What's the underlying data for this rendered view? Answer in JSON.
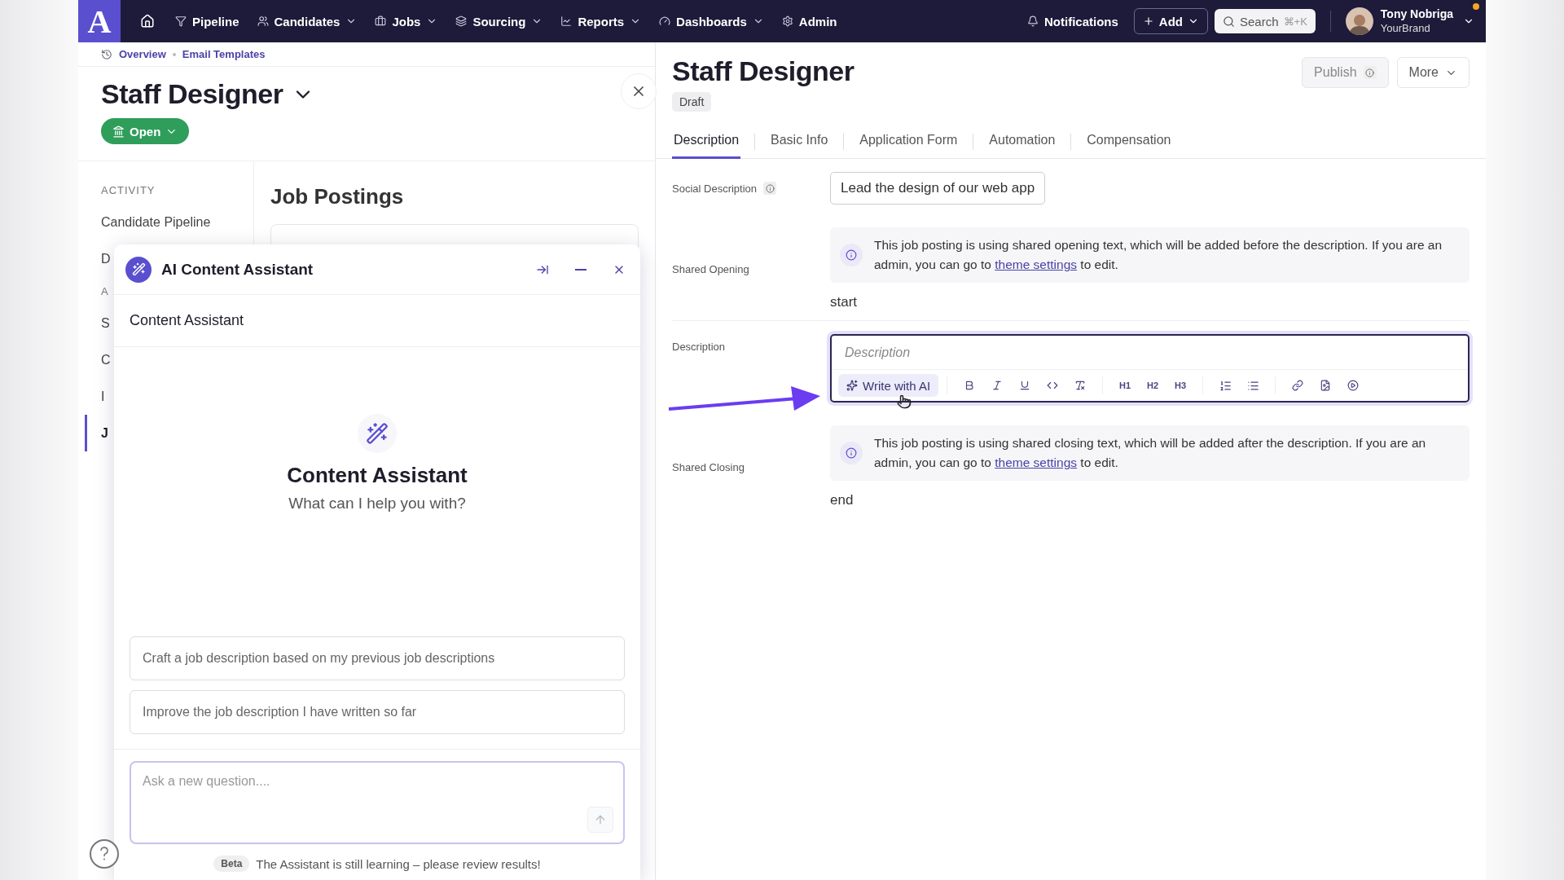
{
  "nav": {
    "logo": "A",
    "items": [
      {
        "label": "Pipeline",
        "dropdown": false
      },
      {
        "label": "Candidates",
        "dropdown": true
      },
      {
        "label": "Jobs",
        "dropdown": true
      },
      {
        "label": "Sourcing",
        "dropdown": true
      },
      {
        "label": "Reports",
        "dropdown": true
      },
      {
        "label": "Dashboards",
        "dropdown": true
      },
      {
        "label": "Admin",
        "dropdown": false
      }
    ],
    "notifications": "Notifications",
    "add": "Add",
    "search": "Search",
    "shortcut": "⌘+K",
    "user": {
      "name": "Tony Nobriga",
      "company": "YourBrand",
      "unread": true
    }
  },
  "left": {
    "breadcrumbs": [
      "Overview",
      "Email Templates"
    ],
    "title": "Staff Designer",
    "status": "Open",
    "sidebar": [
      {
        "kind": "heading",
        "label": "ACTIVITY"
      },
      {
        "kind": "link",
        "label": "Candidate Pipeline",
        "selected": false
      },
      {
        "kind": "link",
        "label": "D",
        "selected": false
      },
      {
        "kind": "heading",
        "label": "A"
      },
      {
        "kind": "link",
        "label": "S",
        "selected": false
      },
      {
        "kind": "link",
        "label": "C",
        "selected": false
      },
      {
        "kind": "link",
        "label": "I",
        "selected": false
      },
      {
        "kind": "link",
        "label": "J",
        "selected": true
      }
    ],
    "section_title": "Job Postings"
  },
  "assistant": {
    "title": "AI Content Assistant",
    "subtitle": "Content Assistant",
    "hero_title": "Content Assistant",
    "hero_text": "What can I help you with?",
    "suggestions": [
      "Craft a job description based on my previous job descriptions",
      "Improve the job description I have written so far"
    ],
    "question": {
      "placeholder": "Ask a new question...."
    },
    "beta": "Beta",
    "footer": "The Assistant is still learning – please review results!"
  },
  "right": {
    "title": "Staff Designer",
    "badge": "Draft",
    "publish": "Publish",
    "more": "More",
    "tabs": [
      {
        "label": "Description",
        "selected": true
      },
      {
        "label": "Basic Info",
        "selected": false
      },
      {
        "label": "Application Form",
        "selected": false
      },
      {
        "label": "Automation",
        "selected": false
      },
      {
        "label": "Compensation",
        "selected": false
      }
    ],
    "social": {
      "label": "Social Description",
      "value": "Lead the design of our web app"
    },
    "opening": {
      "label": "Shared Opening",
      "before": "This job posting is using shared opening text, which will be added before the description. If you are an admin, you can go to ",
      "link": "theme settings",
      "after": " to edit.",
      "text": "start"
    },
    "description": {
      "label": "Description",
      "placeholder": "Description",
      "ai_button": "Write with AI",
      "headings": [
        "H1",
        "H2",
        "H3"
      ]
    },
    "closing": {
      "label": "Shared Closing",
      "before": "This job posting is using shared closing text, which will be added after the description. If you are an admin, you can go to ",
      "link": "theme settings",
      "after": " to edit.",
      "text": "end"
    }
  }
}
